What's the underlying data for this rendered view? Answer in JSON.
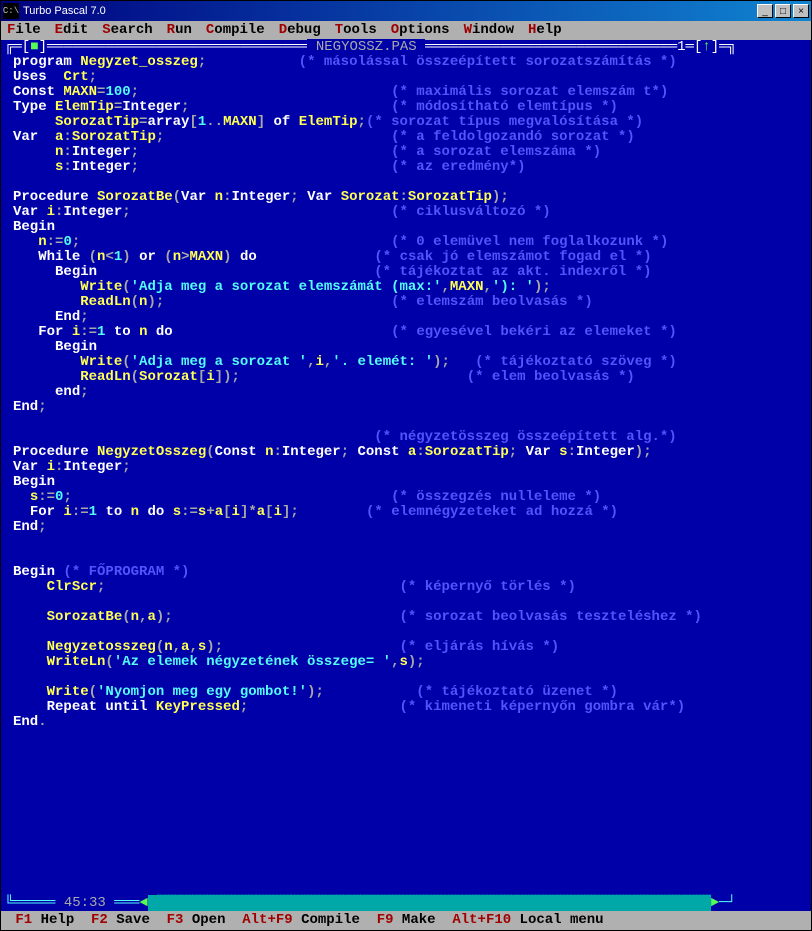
{
  "window": {
    "title": "Turbo Pascal 7.0"
  },
  "menu": {
    "items": [
      {
        "hot": "F",
        "rest": "ile"
      },
      {
        "hot": "E",
        "rest": "dit"
      },
      {
        "hot": "S",
        "rest": "earch"
      },
      {
        "hot": "R",
        "rest": "un"
      },
      {
        "hot": "C",
        "rest": "ompile"
      },
      {
        "hot": "D",
        "rest": "ebug"
      },
      {
        "hot": "T",
        "rest": "ools"
      },
      {
        "hot": "O",
        "rest": "ptions"
      },
      {
        "hot": "W",
        "rest": "indow"
      },
      {
        "hot": "H",
        "rest": "elp"
      }
    ]
  },
  "editor": {
    "filename": " NEGYOSSZ.PAS ",
    "winnum": "1",
    "cursor": " 45:33 "
  },
  "code": {
    "l01a": "program ",
    "l01b": "Negyzet_osszeg",
    "l01c": ";",
    "l01d": "           (* másolással összeépített sorozatszámítás *)",
    "l02a": "Uses  ",
    "l02b": "Crt",
    "l02c": ";",
    "l03a": "Const ",
    "l03b": "MAXN",
    "l03c": "=",
    "l03d": "100",
    "l03e": ";",
    "l03f": "                              (* maximális sorozat elemszám t*)",
    "l04a": "Type ",
    "l04b": "ElemTip",
    "l04c": "=",
    "l04d": "Integer",
    "l04e": ";",
    "l04f": "                        (* módosítható elemtípus *)",
    "l05a": "     ",
    "l05b": "SorozatTip",
    "l05c": "=",
    "l05d": "array",
    "l05e": "[",
    "l05f": "1",
    "l05g": "..",
    "l05h": "MAXN",
    "l05i": "] ",
    "l05j": "of ",
    "l05k": "ElemTip",
    "l05l": ";",
    "l05m": "(* sorozat típus megvalósítása *)",
    "l06a": "Var  ",
    "l06b": "a",
    "l06c": ":",
    "l06d": "SorozatTip",
    "l06e": ";",
    "l06f": "                           (* a feldolgozandó sorozat *)",
    "l07a": "     ",
    "l07b": "n",
    "l07c": ":",
    "l07d": "Integer",
    "l07e": ";",
    "l07f": "                              (* a sorozat elemszáma *)",
    "l08a": "     ",
    "l08b": "s",
    "l08c": ":",
    "l08d": "Integer",
    "l08e": ";",
    "l08f": "                              (* az eredmény*)",
    "l09": " ",
    "l10a": "Procedure ",
    "l10b": "SorozatBe",
    "l10c": "(",
    "l10d": "Var ",
    "l10e": "n",
    "l10f": ":",
    "l10g": "Integer",
    "l10h": "; ",
    "l10i": "Var ",
    "l10j": "Sorozat",
    "l10k": ":",
    "l10l": "SorozatTip",
    "l10m": ");",
    "l11a": "Var ",
    "l11b": "i",
    "l11c": ":",
    "l11d": "Integer",
    "l11e": ";",
    "l11f": "                               (* ciklusváltozó *)",
    "l12a": "Begin",
    "l13a": "   ",
    "l13b": "n",
    "l13c": ":=",
    "l13d": "0",
    "l13e": ";",
    "l13f": "                                     (* 0 elemüvel nem foglalkozunk *)",
    "l14a": "   ",
    "l14b": "While ",
    "l14c": "(",
    "l14d": "n",
    "l14e": "<",
    "l14f": "1",
    "l14g": ") ",
    "l14h": "or ",
    "l14i": "(",
    "l14j": "n",
    "l14k": ">",
    "l14l": "MAXN",
    "l14m": ") ",
    "l14n": "do",
    "l14o": "              (* csak jó elemszámot fogad el *)",
    "l15a": "     ",
    "l15b": "Begin",
    "l15c": "                                 (* tájékoztat az akt. indexről *)",
    "l16a": "        ",
    "l16b": "Write",
    "l16c": "(",
    "l16d": "'Adja meg a sorozat elemszámát (max:'",
    "l16e": ",",
    "l16f": "MAXN",
    "l16g": ",",
    "l16h": "'): '",
    "l16i": ");",
    "l17a": "        ",
    "l17b": "ReadLn",
    "l17c": "(",
    "l17d": "n",
    "l17e": ");",
    "l17f": "                           (* elemszám beolvasás *)",
    "l18a": "     ",
    "l18b": "End",
    "l18c": ";",
    "l19a": "   ",
    "l19b": "For ",
    "l19c": "i",
    "l19d": ":=",
    "l19e": "1 ",
    "l19f": "to ",
    "l19g": "n ",
    "l19h": "do",
    "l19i": "                          (* egyesével bekéri az elemeket *)",
    "l20a": "     ",
    "l20b": "Begin",
    "l21a": "        ",
    "l21b": "Write",
    "l21c": "(",
    "l21d": "'Adja meg a sorozat '",
    "l21e": ",",
    "l21f": "i",
    "l21g": ",",
    "l21h": "'. elemét: '",
    "l21i": ");   ",
    "l21j": "(* tájékoztató szöveg *)",
    "l22a": "        ",
    "l22b": "ReadLn",
    "l22c": "(",
    "l22d": "Sorozat",
    "l22e": "[",
    "l22f": "i",
    "l22g": "]);",
    "l22h": "                           (* elem beolvasás *)",
    "l23a": "     ",
    "l23b": "end",
    "l23c": ";",
    "l24a": "End",
    "l24b": ";",
    "l25": " ",
    "l26a": "                                           (* négyzetösszeg összeépített alg.*)",
    "l27a": "Procedure ",
    "l27b": "NegyzetOsszeg",
    "l27c": "(",
    "l27d": "Const ",
    "l27e": "n",
    "l27f": ":",
    "l27g": "Integer",
    "l27h": "; ",
    "l27i": "Const ",
    "l27j": "a",
    "l27k": ":",
    "l27l": "SorozatTip",
    "l27m": "; ",
    "l27n": "Var ",
    "l27o": "s",
    "l27p": ":",
    "l27q": "Integer",
    "l27r": ");",
    "l28a": "Var ",
    "l28b": "i",
    "l28c": ":",
    "l28d": "Integer",
    "l28e": ";",
    "l29a": "Begin",
    "l30a": "  ",
    "l30b": "s",
    "l30c": ":=",
    "l30d": "0",
    "l30e": ";",
    "l30f": "                                      (* összegzés nulleleme *)",
    "l31a": "  ",
    "l31b": "For ",
    "l31c": "i",
    "l31d": ":=",
    "l31e": "1 ",
    "l31f": "to ",
    "l31g": "n ",
    "l31h": "do ",
    "l31i": "s",
    "l31j": ":=",
    "l31k": "s",
    "l31l": "+",
    "l31m": "a",
    "l31n": "[",
    "l31o": "i",
    "l31p": "]*",
    "l31q": "a",
    "l31r": "[",
    "l31s": "i",
    "l31t": "];",
    "l31u": "        (* elemnégyzeteket ad hozzá *)",
    "l32a": "End",
    "l32b": ";",
    "l33": " ",
    "l34": " ",
    "l35a": "Begin ",
    "l35b": "(* FŐPROGRAM *)",
    "l36a": "    ",
    "l36b": "ClrScr",
    "l36c": ";",
    "l36d": "                                   (* képernyő törlés *)",
    "l37": " ",
    "l38a": "    ",
    "l38b": "SorozatBe",
    "l38c": "(",
    "l38d": "n",
    "l38e": ",",
    "l38f": "a",
    "l38g": ");",
    "l38h": "                           (* sorozat beolvasás teszteléshez *)",
    "l39": " ",
    "l40a": "    ",
    "l40b": "Negyzetosszeg",
    "l40c": "(",
    "l40d": "n",
    "l40e": ",",
    "l40f": "a",
    "l40g": ",",
    "l40h": "s",
    "l40i": ");",
    "l40j": "                     (* eljárás hívás *)",
    "l41a": "    ",
    "l41b": "WriteLn",
    "l41c": "(",
    "l41d": "'Az elemek négyzetének összege= '",
    "l41e": ",",
    "l41f": "s",
    "l41g": ");",
    "l42": " ",
    "l43a": "    ",
    "l43b": "Write",
    "l43c": "(",
    "l43d": "'Nyomjon meg egy gombot!'",
    "l43e": ");",
    "l43f": "           (* tájékoztató üzenet *)",
    "l44a": "    ",
    "l44b": "Repeat until ",
    "l44c": "KeyPressed",
    "l44d": ";",
    "l44e": "                  (* kimeneti képernyőn gombra vár*)",
    "l45a": "End",
    "l45b": "."
  },
  "status": {
    "items": [
      {
        "k": "F1",
        "v": " Help  "
      },
      {
        "k": "F2",
        "v": " Save  "
      },
      {
        "k": "F3",
        "v": " Open  "
      },
      {
        "k": "Alt+F9",
        "v": " Compile  "
      },
      {
        "k": "F9",
        "v": " Make  "
      },
      {
        "k": "Alt+F10",
        "v": " Local menu"
      }
    ]
  }
}
